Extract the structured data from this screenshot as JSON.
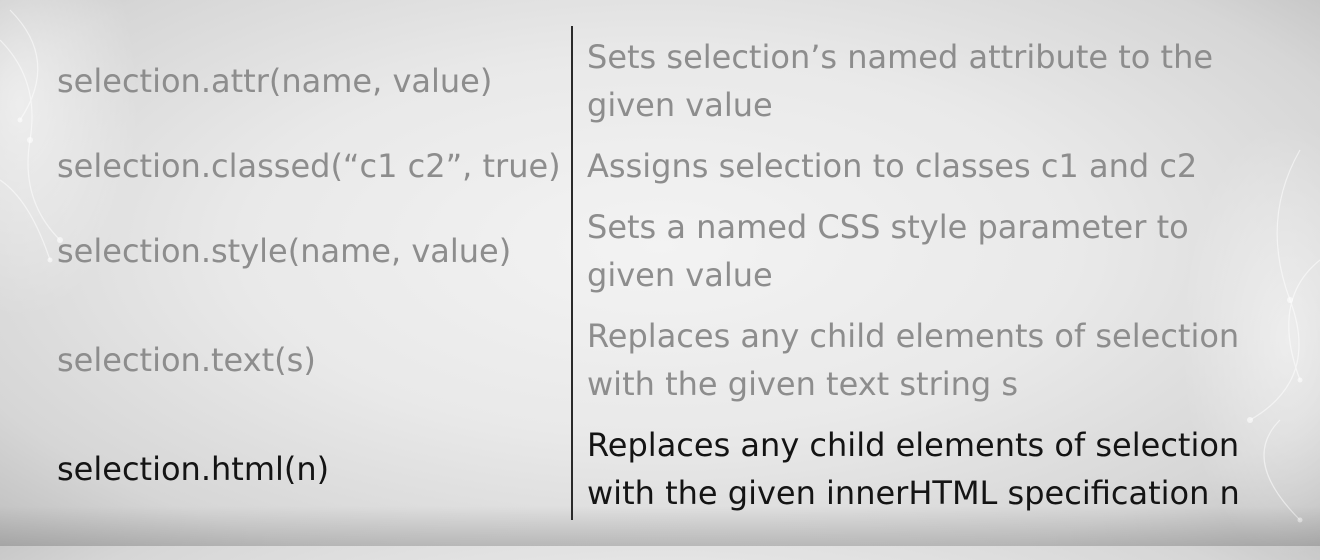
{
  "rows": [
    {
      "method": "selection.attr(name, value)",
      "desc_line1": "Sets selection’s named attribute to the",
      "desc_line2": "given value"
    },
    {
      "method": "selection.classed(“c1 c2”, true)",
      "desc_line1": "Assigns selection to classes c1 and c2"
    },
    {
      "method": "selection.style(name, value)",
      "desc_line1": "Sets a named CSS style parameter to",
      "desc_line2": "given value"
    },
    {
      "method": "selection.text(s)",
      "desc_line1": "Replaces any child elements of selection",
      "desc_line2": "with the given text string s"
    },
    {
      "method": "selection.html(n)",
      "desc_line1": "Replaces any child elements of selection",
      "desc_line2": "with the given innerHTML specification n"
    }
  ],
  "colors": {
    "muted_text": "#8d8d8d",
    "active_text": "#141414",
    "divider": "#2a2a2a"
  }
}
